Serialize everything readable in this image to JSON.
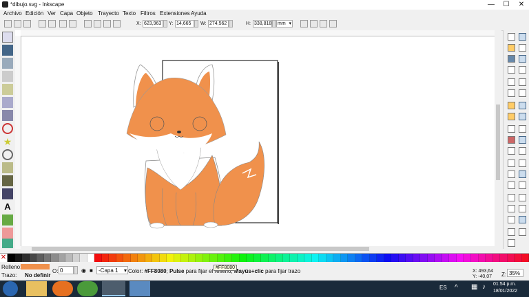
{
  "window": {
    "title": "*dibujo.svg - Inkscape",
    "minimize": "—",
    "maximize": "☐",
    "close": "✕"
  },
  "menu": [
    "Archivo",
    "Edición",
    "Ver",
    "Capa",
    "Objeto",
    "Trayecto",
    "Texto",
    "Filtros",
    "Extensiones",
    "Ayuda"
  ],
  "coords": {
    "x_label": "X:",
    "x": "623,963",
    "y_label": "Y:",
    "y": "14,665",
    "w_label": "W:",
    "w": "274,562",
    "h_label": "H:",
    "h": "338,818",
    "unit": "mm"
  },
  "status": {
    "fill_label": "Relleno:",
    "stroke_label": "Trazo:",
    "stroke_value": "No definir",
    "opacity_label": "O:",
    "opacity": "0",
    "layer": "-Capa 1",
    "message_color": "Color: ",
    "message_hex": "#FF8080",
    "message_rest": "; ",
    "message_pulse": "Pulse",
    "message_mid": " para fijar el relleno, ",
    "message_shift": "Mayús+clic",
    "message_end": " para fijar trazo",
    "tooltip": "#FF8080",
    "cursor_x": "X: 493,64",
    "cursor_y": "Y: -40,07",
    "zoom_label": "Z:",
    "zoom": "35%"
  },
  "taskbar": {
    "lang": "ES",
    "time": "01:54 p.m.",
    "date": "18/01/2022"
  },
  "colors": {
    "fill_swatch": "#f0914c",
    "fox_orange": "#f0914c",
    "accent": "#1a5fb4"
  }
}
